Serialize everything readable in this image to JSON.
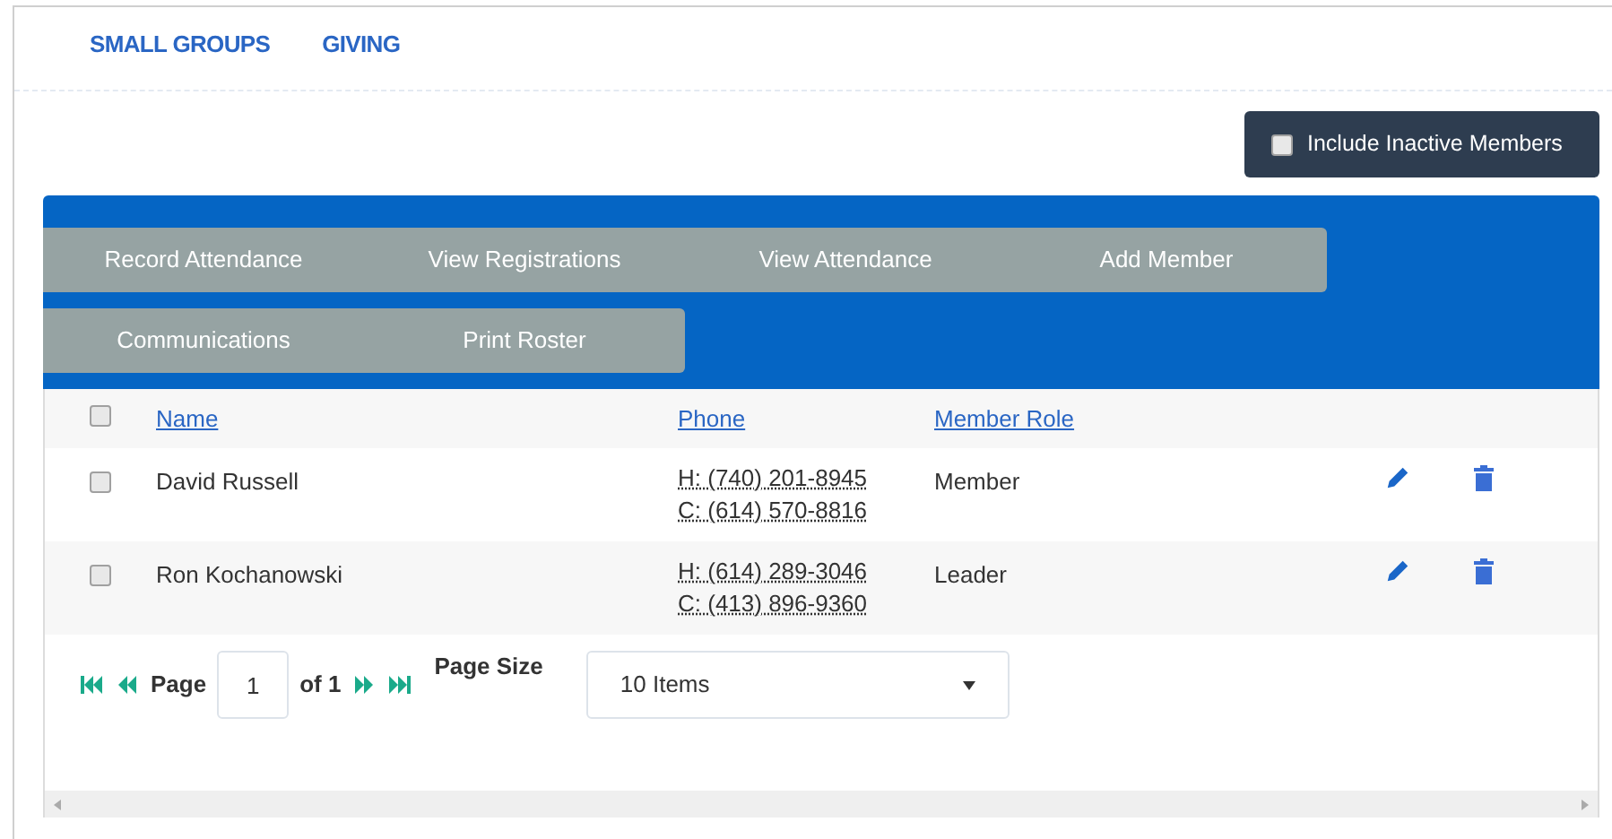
{
  "nav": [
    {
      "label": "SMALL GROUPS"
    },
    {
      "label": "GIVING"
    }
  ],
  "include_inactive": {
    "label": "Include Inactive Members",
    "checked": false
  },
  "actions": [
    [
      "Record Attendance",
      "View Registrations",
      "View Attendance",
      "Add Member"
    ],
    [
      "Communications",
      "Print Roster"
    ]
  ],
  "table": {
    "select_all": false,
    "columns": [
      "Name",
      "Phone",
      "Member Role"
    ],
    "rows": [
      {
        "checked": false,
        "name": "David Russell",
        "phones": [
          "H: (740) 201-8945",
          "C: (614) 570-8816"
        ],
        "role": "Member"
      },
      {
        "checked": false,
        "name": "Ron Kochanowski",
        "phones": [
          "H: (614) 289-3046",
          "C: (413) 896-9360"
        ],
        "role": "Leader"
      }
    ]
  },
  "pager": {
    "page_label": "Page",
    "page": "1",
    "of_label": "of 1",
    "page_size_label": "Page Size",
    "page_size": "10 Items"
  }
}
